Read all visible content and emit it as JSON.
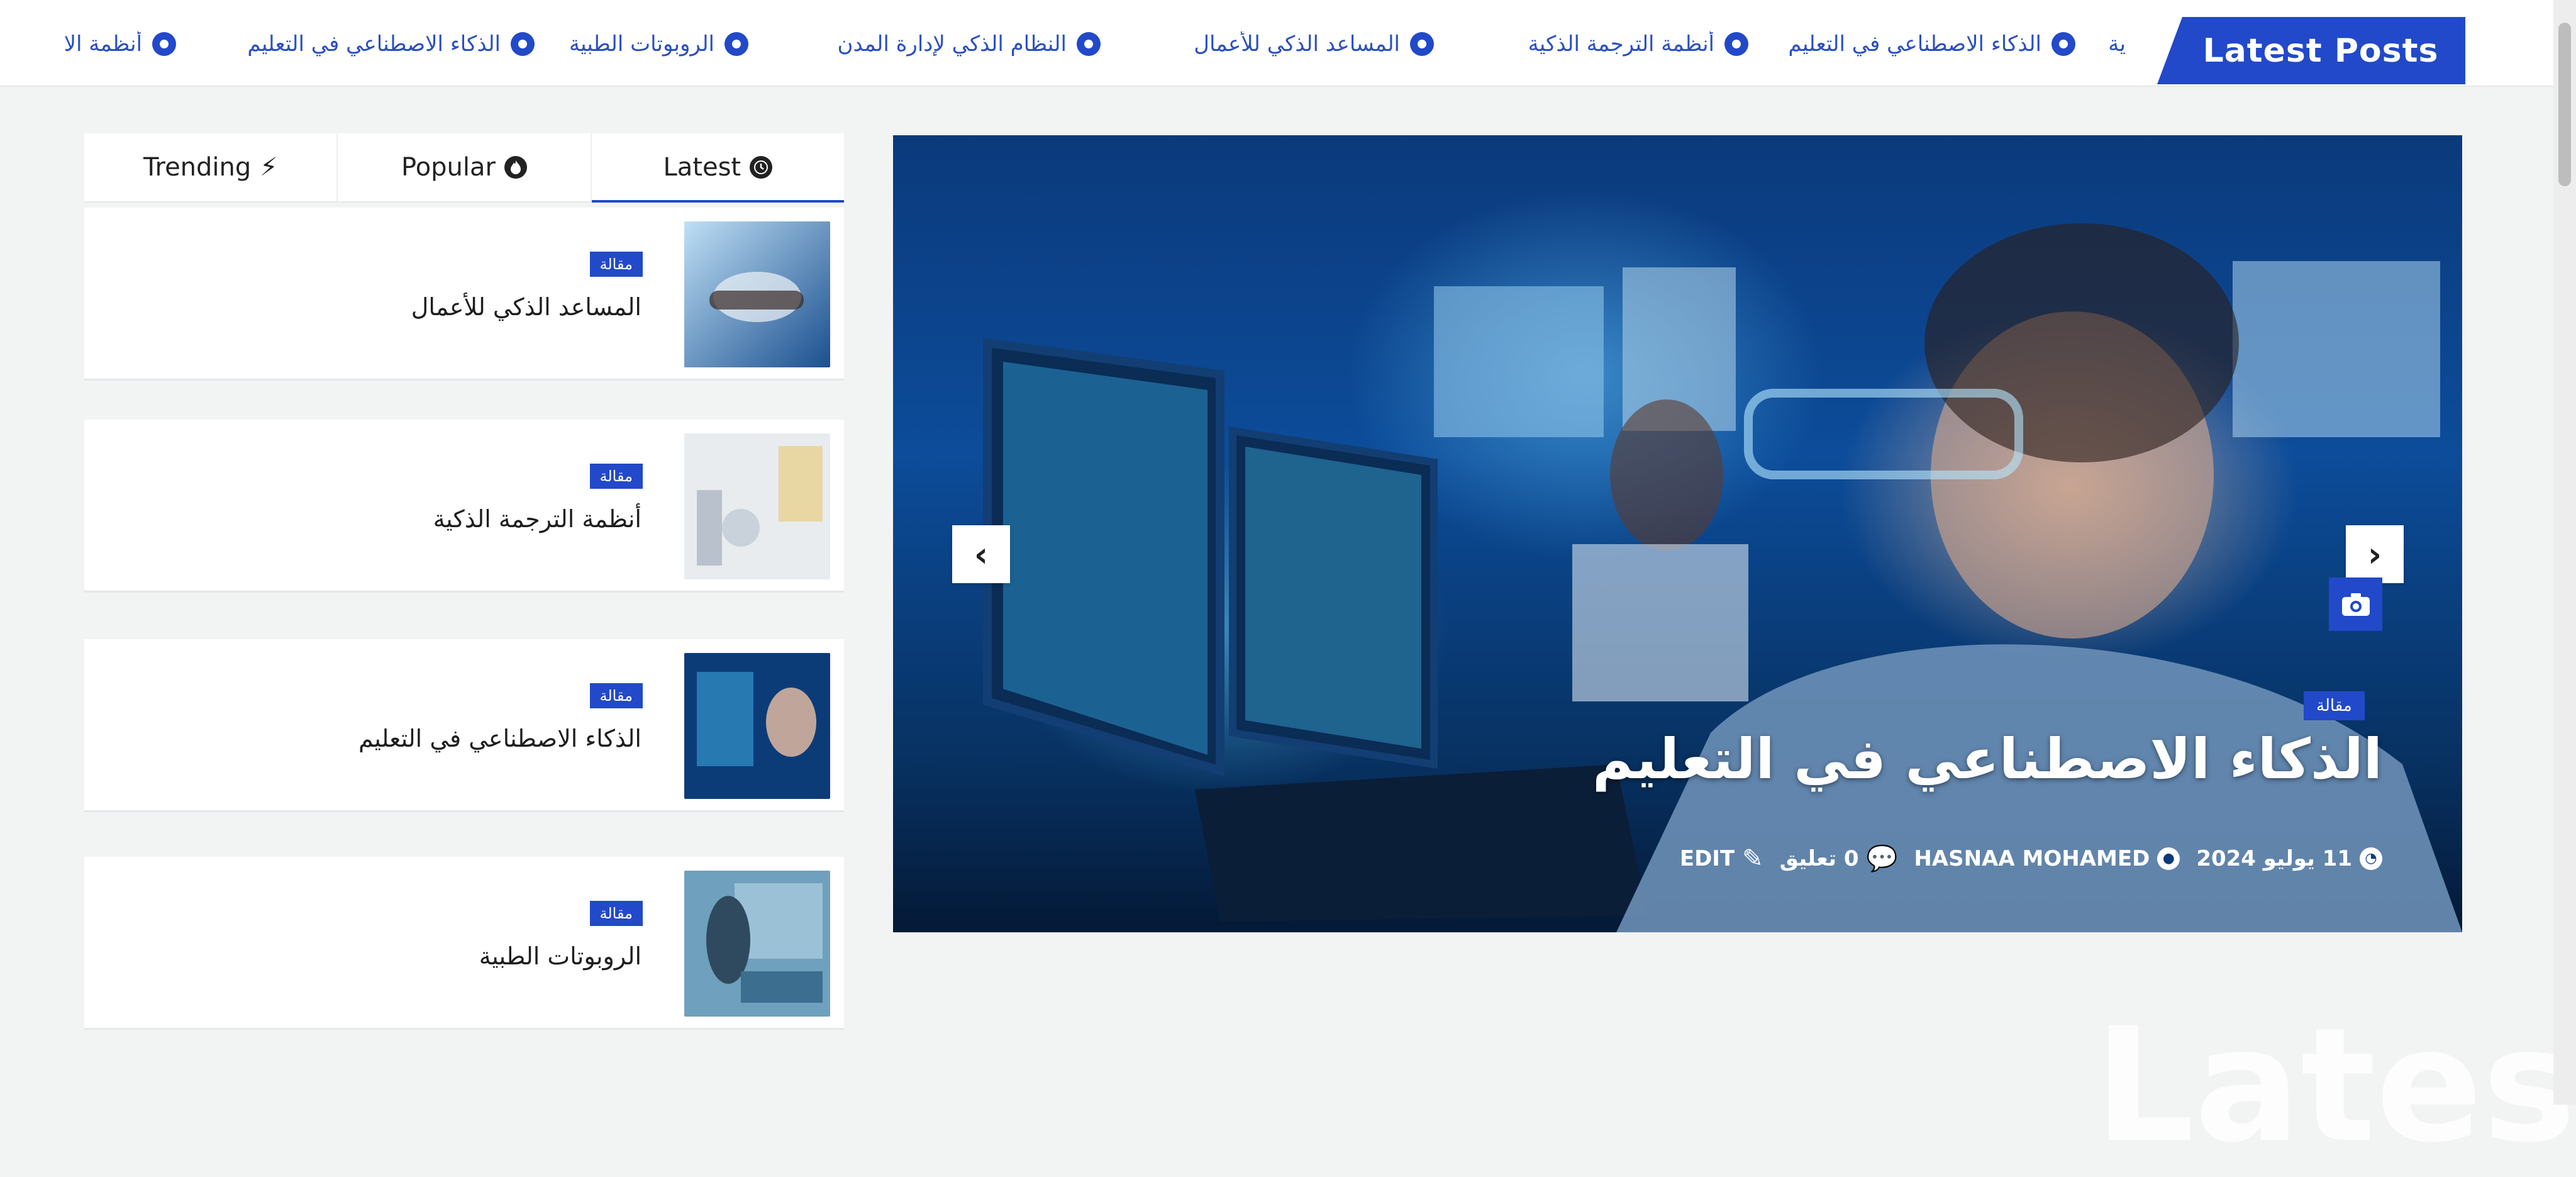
{
  "ticker": {
    "label": "Latest Posts",
    "items": [
      "ية",
      "الذكاء الاصطناعي في التعليم",
      "أنظمة الترجمة الذكية",
      "المساعد الذكي للأعمال",
      "النظام الذكي لإدارة المدن",
      "الروبوتات الطبية",
      "الذكاء الاصطناعي في التعليم",
      "أنظمة الا"
    ]
  },
  "tabs": {
    "items": [
      {
        "label": "Trending",
        "icon": "bolt-icon"
      },
      {
        "label": "Popular",
        "icon": "flame-icon"
      },
      {
        "label": "Latest",
        "icon": "clock-icon"
      }
    ],
    "active": "Latest"
  },
  "posts": [
    {
      "category": "مقالة",
      "title": "المساعد الذكي للأعمال",
      "thumb": "handshake"
    },
    {
      "category": "مقالة",
      "title": "أنظمة الترجمة الذكية",
      "thumb": "lab"
    },
    {
      "category": "مقالة",
      "title": "الذكاء الاصطناعي في التعليم",
      "thumb": "student"
    },
    {
      "category": "مقالة",
      "title": "الروبوتات الطبية",
      "thumb": "medical"
    }
  ],
  "slider": {
    "category": "مقالة",
    "title": "الذكاء الاصطناعي في التعليم",
    "date": "11 يوليو 2024",
    "author": "HASNAA MOHAMED",
    "comments": "0 تعليق",
    "edit": "EDIT",
    "prev_icon": "chevron-left-icon",
    "next_icon": "chevron-right-icon",
    "camera_icon": "camera-icon"
  },
  "colors": {
    "accent": "#2149c9",
    "background": "#f2f3f3",
    "card": "#ffffff"
  },
  "watermark": "Latest"
}
